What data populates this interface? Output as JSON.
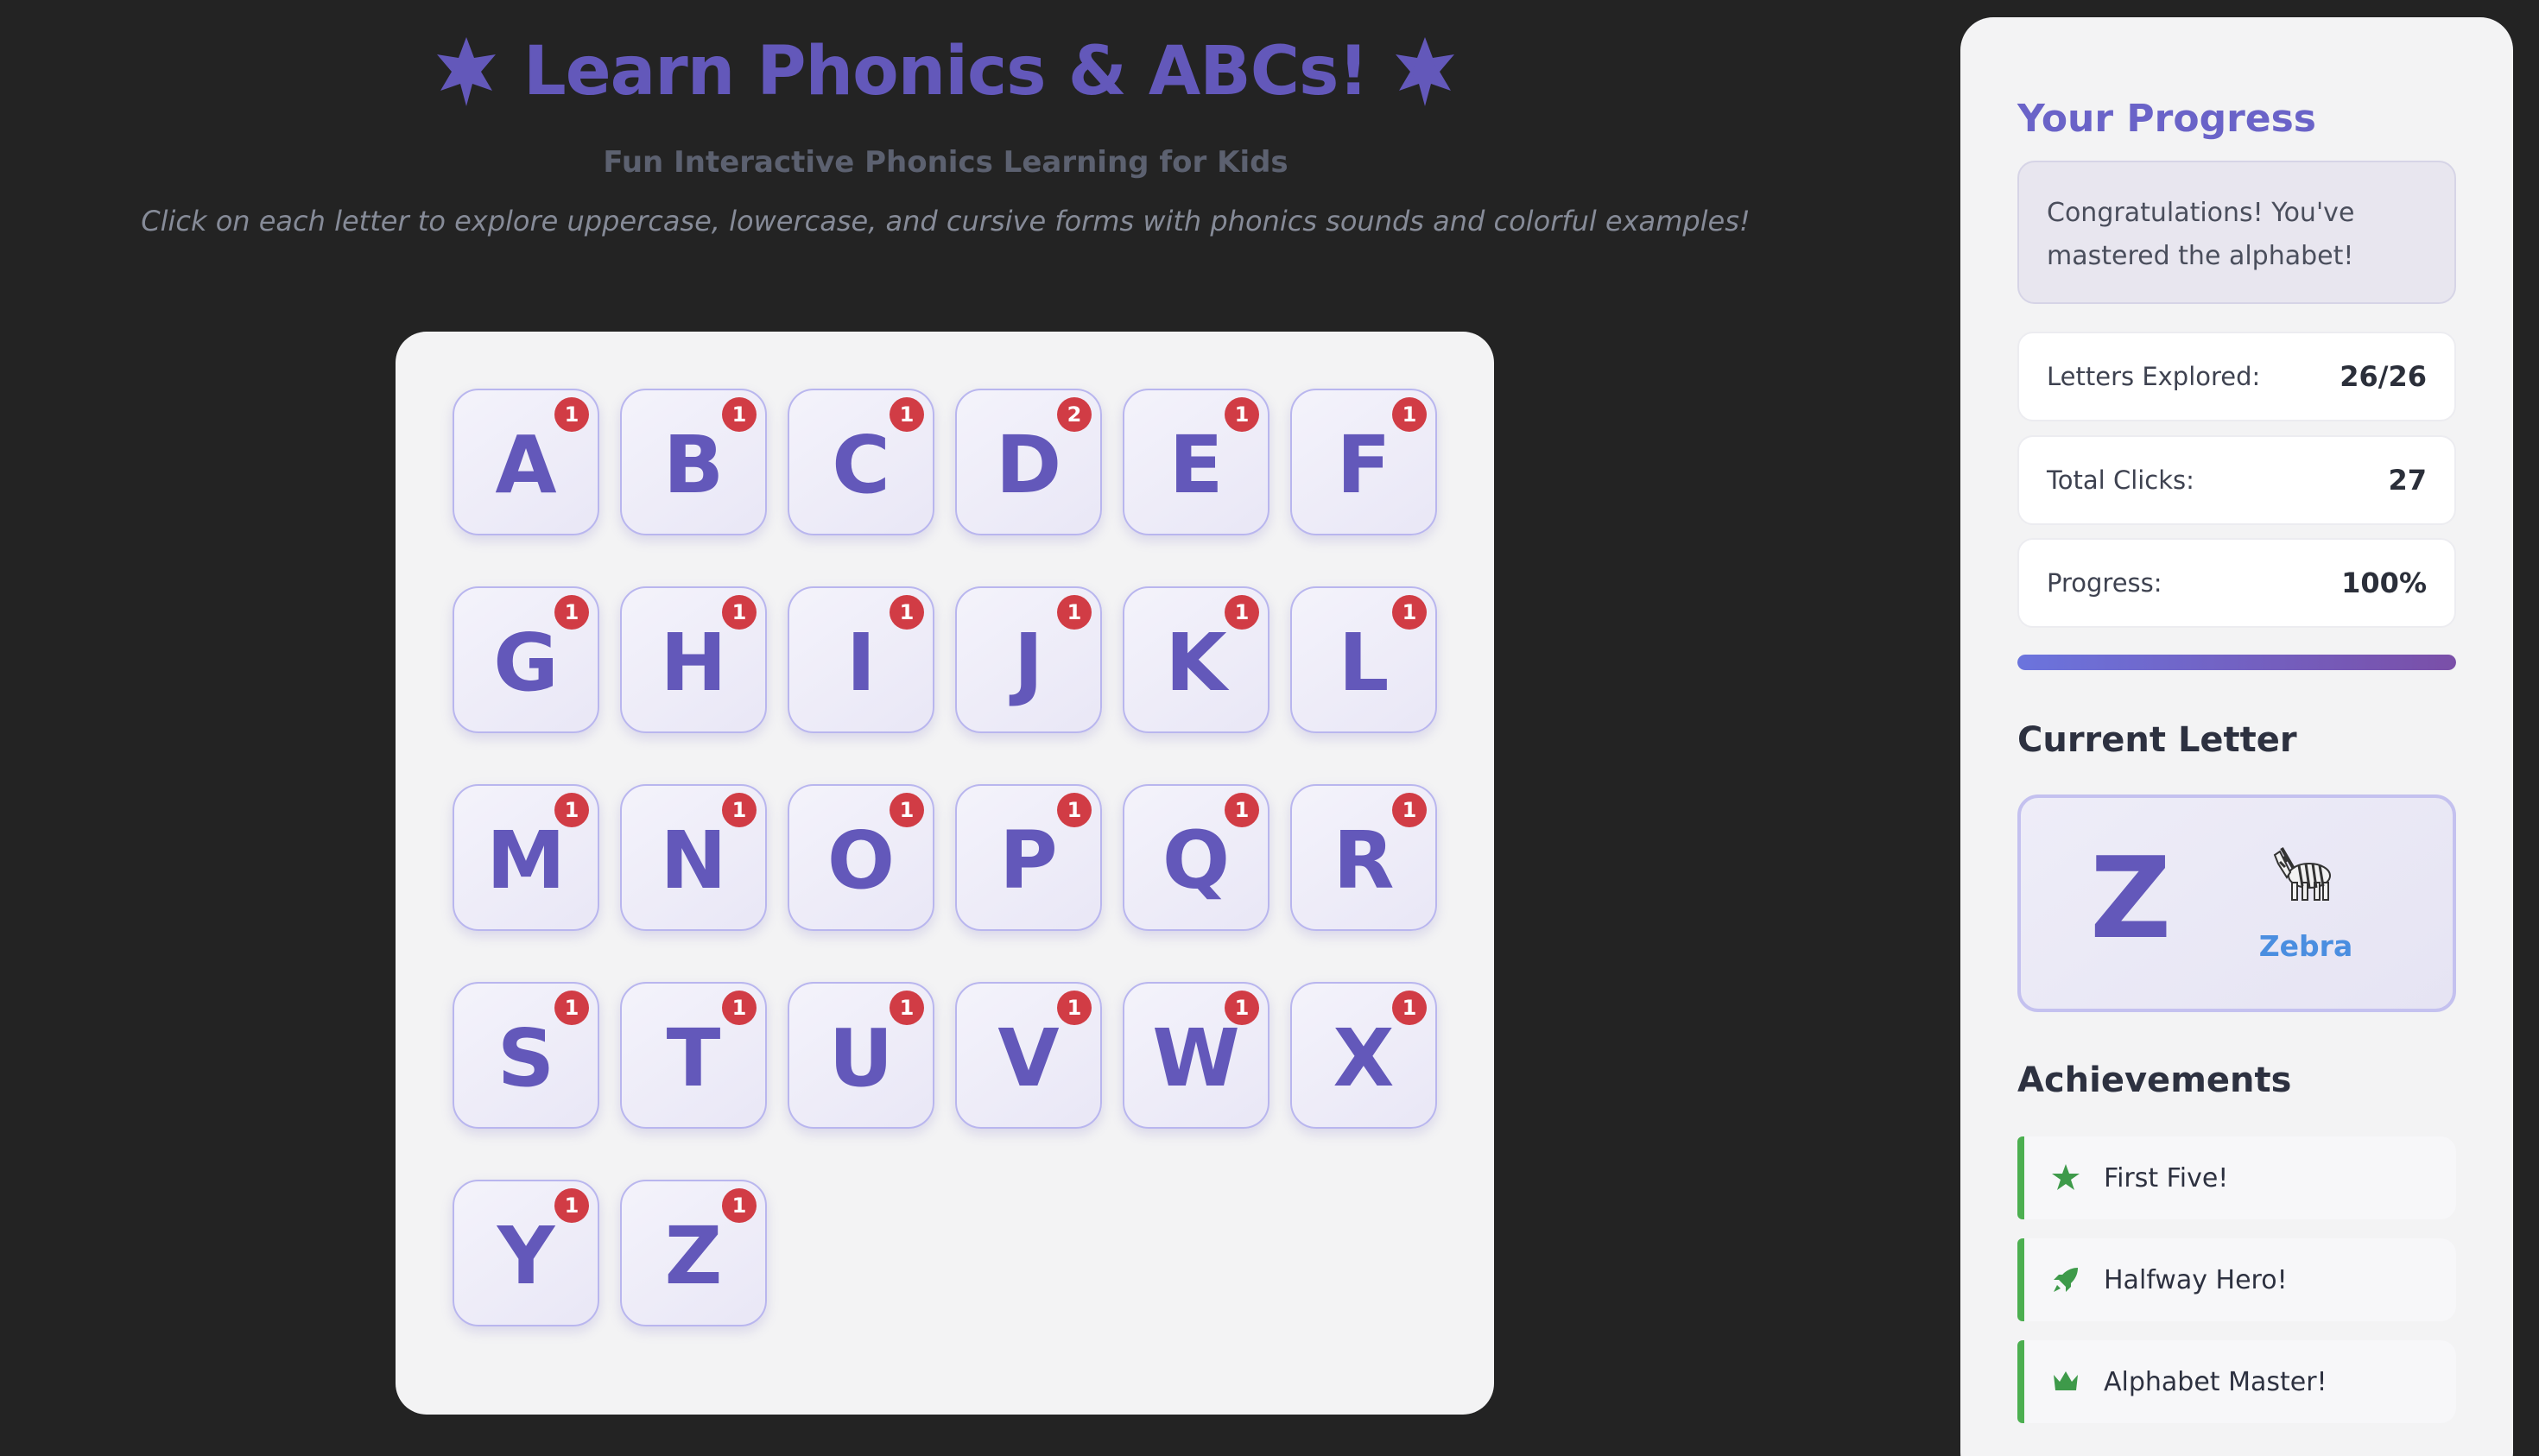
{
  "header": {
    "title": "Learn Phonics & ABCs!",
    "title_icon": "star-icon",
    "subtitle": "Fun Interactive Phonics Learning for Kids",
    "instructions": "Click on each letter to explore uppercase, lowercase, and cursive forms with phonics sounds and colorful examples!"
  },
  "letters": [
    {
      "letter": "A",
      "clicks": "1"
    },
    {
      "letter": "B",
      "clicks": "1"
    },
    {
      "letter": "C",
      "clicks": "1"
    },
    {
      "letter": "D",
      "clicks": "2"
    },
    {
      "letter": "E",
      "clicks": "1"
    },
    {
      "letter": "F",
      "clicks": "1"
    },
    {
      "letter": "G",
      "clicks": "1"
    },
    {
      "letter": "H",
      "clicks": "1"
    },
    {
      "letter": "I",
      "clicks": "1"
    },
    {
      "letter": "J",
      "clicks": "1"
    },
    {
      "letter": "K",
      "clicks": "1"
    },
    {
      "letter": "L",
      "clicks": "1"
    },
    {
      "letter": "M",
      "clicks": "1"
    },
    {
      "letter": "N",
      "clicks": "1"
    },
    {
      "letter": "O",
      "clicks": "1"
    },
    {
      "letter": "P",
      "clicks": "1"
    },
    {
      "letter": "Q",
      "clicks": "1"
    },
    {
      "letter": "R",
      "clicks": "1"
    },
    {
      "letter": "S",
      "clicks": "1"
    },
    {
      "letter": "T",
      "clicks": "1"
    },
    {
      "letter": "U",
      "clicks": "1"
    },
    {
      "letter": "V",
      "clicks": "1"
    },
    {
      "letter": "W",
      "clicks": "1"
    },
    {
      "letter": "X",
      "clicks": "1"
    },
    {
      "letter": "Y",
      "clicks": "1"
    },
    {
      "letter": "Z",
      "clicks": "1"
    }
  ],
  "sidebar": {
    "progress_heading": "Your Progress",
    "congrats_message": "Congratulations! You've mastered the alphabet!",
    "stats": [
      {
        "label": "Letters Explored:",
        "value": "26/26"
      },
      {
        "label": "Total Clicks:",
        "value": "27"
      },
      {
        "label": "Progress:",
        "value": "100%"
      }
    ],
    "progress_fraction": 1.0,
    "current_letter_heading": "Current Letter",
    "current_letter": "Z",
    "current_example_icon": "zebra-icon",
    "current_example_word": "Zebra",
    "achievements_heading": "Achievements",
    "achievements": [
      {
        "label": "First Five!",
        "icon": "star-icon"
      },
      {
        "label": "Halfway Hero!",
        "icon": "rocket-icon"
      },
      {
        "label": "Alphabet Master!",
        "icon": "crown-icon"
      }
    ]
  },
  "colors": {
    "background": "#232323",
    "accent": "#6358ba",
    "badge": "#d13c45",
    "achievement": "#4caf50",
    "example_word": "#4a8ee0"
  }
}
